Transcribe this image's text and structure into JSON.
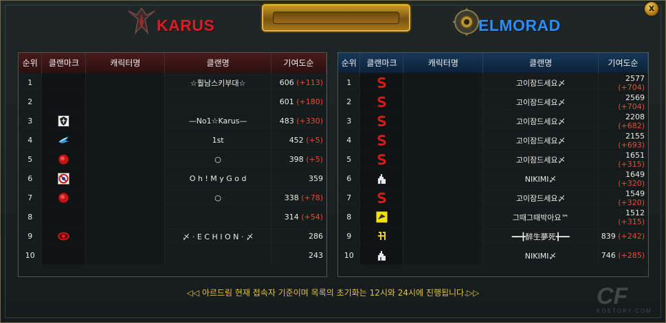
{
  "header": {
    "karus_title": "KARUS",
    "elmorad_title": "ELMORAD",
    "close_label": "x"
  },
  "columns": [
    "순위",
    "클랜마크",
    "캐릭터명",
    "클랜명",
    "기여도순"
  ],
  "karus_rows": [
    {
      "rank": "1",
      "mark": "",
      "char": "",
      "clan": "☆훨남스키부대☆",
      "score": "606",
      "delta": "(+113)"
    },
    {
      "rank": "2",
      "mark": "",
      "char": "",
      "clan": "",
      "score": "601",
      "delta": "(+180)"
    },
    {
      "rank": "3",
      "mark": "shield-emblem-icon",
      "char": "",
      "clan": "—No1☆Karus—",
      "score": "483",
      "delta": "(+330)"
    },
    {
      "rank": "4",
      "mark": "blue-wings-icon",
      "char": "",
      "clan": "1st",
      "score": "452",
      "delta": "(+5)"
    },
    {
      "rank": "5",
      "mark": "red-moon-icon",
      "char": "",
      "clan": "○",
      "score": "398",
      "delta": "(+5)"
    },
    {
      "rank": "6",
      "mark": "no-sign-icon",
      "char": "",
      "clan": "O h ! M y G o d",
      "score": "359",
      "delta": ""
    },
    {
      "rank": "7",
      "mark": "red-moon-icon",
      "char": "",
      "clan": "○",
      "score": "338",
      "delta": "(+78)"
    },
    {
      "rank": "8",
      "mark": "",
      "char": "",
      "clan": "",
      "score": "314",
      "delta": "(+54)"
    },
    {
      "rank": "9",
      "mark": "red-eye-icon",
      "char": "",
      "clan": "〆 · E C H I O N · 〆",
      "score": "286",
      "delta": ""
    },
    {
      "rank": "10",
      "mark": "",
      "char": "",
      "clan": "",
      "score": "243",
      "delta": ""
    }
  ],
  "elmorad_rows": [
    {
      "rank": "1",
      "mark": "red-s-icon",
      "char": "",
      "clan": "고이잠드세요〆",
      "score": "2577",
      "delta": "(+704)"
    },
    {
      "rank": "2",
      "mark": "red-s-icon",
      "char": "",
      "clan": "고이잠드세요〆",
      "score": "2569",
      "delta": "(+704)"
    },
    {
      "rank": "3",
      "mark": "red-s-icon",
      "char": "",
      "clan": "고이잠드세요〆",
      "score": "2208",
      "delta": "(+682)"
    },
    {
      "rank": "4",
      "mark": "red-s-icon",
      "char": "",
      "clan": "고이잠드세요〆",
      "score": "2155",
      "delta": "(+693)"
    },
    {
      "rank": "5",
      "mark": "red-s-icon",
      "char": "",
      "clan": "고이잠드세요〆",
      "score": "1651",
      "delta": "(+315)"
    },
    {
      "rank": "6",
      "mark": "white-castle-icon",
      "char": "",
      "clan": "NIKIMI〆",
      "score": "1649",
      "delta": "(+320)"
    },
    {
      "rank": "7",
      "mark": "red-s-icon",
      "char": "",
      "clan": "고이잠드세요〆",
      "score": "1549",
      "delta": "(+320)"
    },
    {
      "rank": "8",
      "mark": "yellow-sign-icon",
      "char": "",
      "clan": "그때그때박아요™",
      "score": "1512",
      "delta": "(+315)"
    },
    {
      "rank": "9",
      "mark": "yellow-glyph-icon",
      "char": "",
      "clan": "━━╋醉生夢死╋━━",
      "score": "839",
      "delta": "(+242)"
    },
    {
      "rank": "10",
      "mark": "white-castle-icon",
      "char": "",
      "clan": "NIKIMI〆",
      "score": "746",
      "delta": "(+285)"
    }
  ],
  "footer": {
    "notice": "◁◁ 아르드림 현재 접속자 기준이며 목록의 초기화는 12시와 24시에 진행됩니다.▷▷"
  },
  "watermark": {
    "logo": "CF",
    "text": "KOSTORY.COM"
  },
  "colors": {
    "karus": "#d4202a",
    "elmorad": "#2f8cf0",
    "delta": "#e0503a",
    "footer": "#e5c24a"
  }
}
